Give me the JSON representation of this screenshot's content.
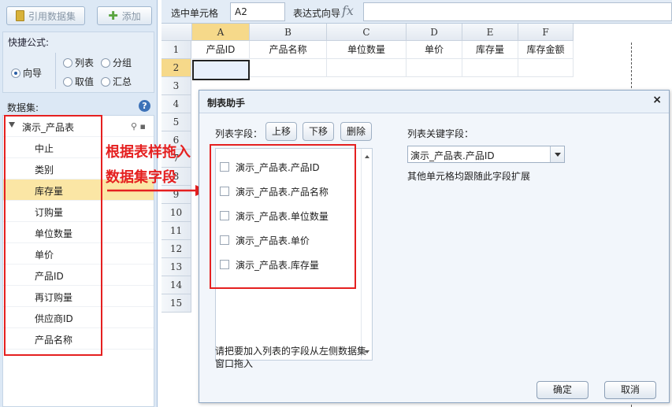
{
  "left_panel": {
    "ref_dataset_label": "引用数据集",
    "add_label": "添加",
    "formula": {
      "title": "快捷公式:",
      "options": [
        "向导",
        "列表",
        "分组",
        "取值",
        "汇总"
      ],
      "selected": "向导"
    },
    "dataset": {
      "title": "数据集:",
      "root": "演示_产品表",
      "fields": [
        "中止",
        "类别",
        "库存量",
        "订购量",
        "单位数量",
        "单价",
        "产品ID",
        "再订购量",
        "供应商ID",
        "产品名称"
      ],
      "selected_field": "库存量"
    }
  },
  "annotation": {
    "line1": "根据表样拖入",
    "line2": "数据集字段",
    "color": "#e52020"
  },
  "formula_bar": {
    "cell_label": "选中单元格",
    "cell_ref": "A2",
    "expr_label": "表达式向导",
    "fx": "fx"
  },
  "grid": {
    "columns": [
      "A",
      "B",
      "C",
      "D",
      "E",
      "F"
    ],
    "rows": [
      "1",
      "2",
      "3",
      "4",
      "5",
      "6",
      "7",
      "8",
      "9",
      "10",
      "11",
      "12",
      "13",
      "14",
      "15"
    ],
    "header_values": [
      "产品ID",
      "产品名称",
      "单位数量",
      "单价",
      "库存量",
      "库存金额"
    ]
  },
  "dialog": {
    "title": "制表助手",
    "close": "×",
    "list_field_label": "列表字段：",
    "up_label": "上移",
    "down_label": "下移",
    "delete_label": "删除",
    "fields": [
      "演示_产品表.产品ID",
      "演示_产品表.产品名称",
      "演示_产品表.单位数量",
      "演示_产品表.单价",
      "演示_产品表.库存量"
    ],
    "hint_line1": "请把要加入列表的字段从左侧数据集",
    "hint_line2": "窗口拖入",
    "key_field_label": "列表关键字段：",
    "key_field_value": "演示_产品表.产品ID",
    "key_note": "其他单元格均跟随此字段扩展",
    "ok_label": "确定",
    "cancel_label": "取消"
  }
}
